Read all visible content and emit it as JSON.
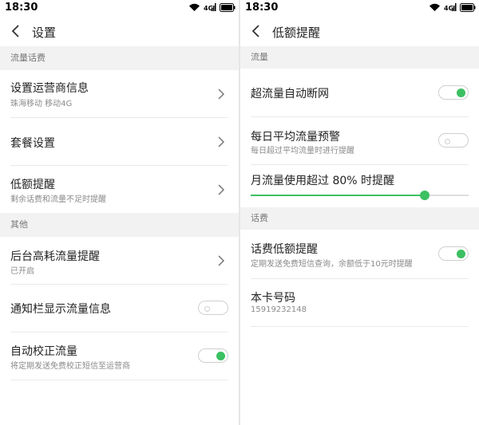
{
  "status": {
    "time": "18:30"
  },
  "left": {
    "title": "设置",
    "section1": "流量话费",
    "row_operator": {
      "label": "设置运营商信息",
      "sub": "珠海移动 移动4G"
    },
    "row_plan": {
      "label": "套餐设置"
    },
    "row_low": {
      "label": "低额提醒",
      "sub": "剩余话费和流量不足时提醒"
    },
    "section2": "其他",
    "row_background": {
      "label": "后台高耗流量提醒",
      "sub": "已开启"
    },
    "row_notify": {
      "label": "通知栏显示流量信息",
      "on": false
    },
    "row_calibrate": {
      "label": "自动校正流量",
      "sub": "将定期发送免费校正短信至运营商",
      "on": true
    }
  },
  "right": {
    "title": "低额提醒",
    "section1": "流量",
    "row_cutoff": {
      "label": "超流量自动断网",
      "on": true
    },
    "row_daily": {
      "label": "每日平均流量预警",
      "sub": "每日超过平均流量时进行提醒",
      "on": false
    },
    "row_monthly": {
      "label": "月流量使用超过 80% 时提醒",
      "percent": 80
    },
    "section2": "话费",
    "row_fee_low": {
      "label": "话费低额提醒",
      "sub": "定期发送免费短信查询，余额低于10元时提醒",
      "on": true
    },
    "row_number": {
      "label": "本卡号码",
      "value": "15919232148"
    }
  },
  "colors": {
    "accent": "#3cc061",
    "section_bg": "#f2f2f2"
  }
}
